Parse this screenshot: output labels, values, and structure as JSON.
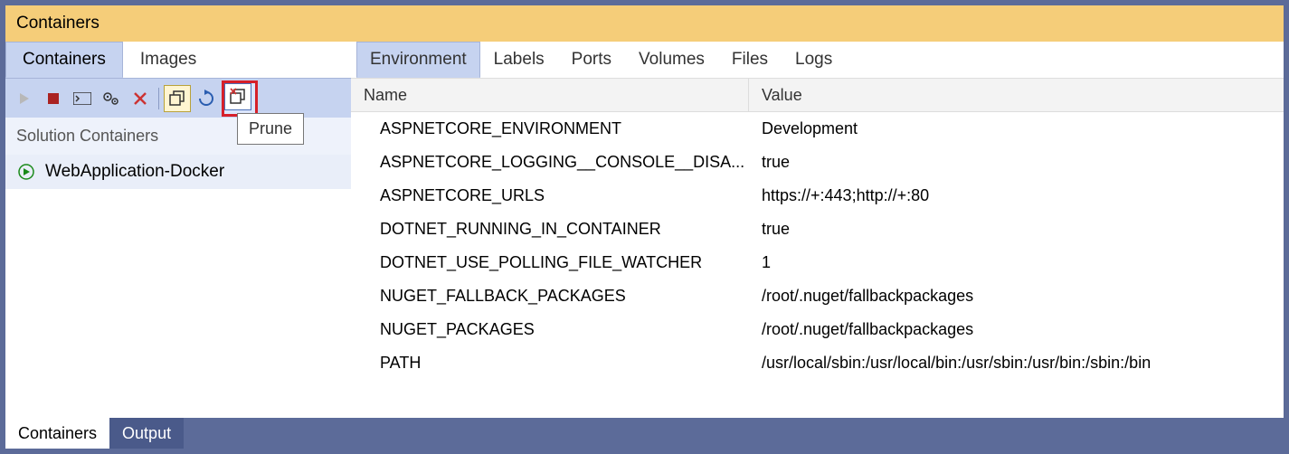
{
  "title": "Containers",
  "left_tabs": [
    "Containers",
    "Images"
  ],
  "left_active_tab": 0,
  "toolbar": {
    "play": "play-icon",
    "stop": "stop-icon",
    "terminal": "terminal-icon",
    "settings": "settings-icon",
    "delete": "delete-icon",
    "prune_stopped": "prune-stopped-icon",
    "refresh": "refresh-icon",
    "prune": "prune-icon",
    "tooltip": "Prune"
  },
  "section_header": "Solution Containers",
  "containers": [
    {
      "name": "WebApplication-Docker",
      "running": true
    }
  ],
  "right_tabs": [
    "Environment",
    "Labels",
    "Ports",
    "Volumes",
    "Files",
    "Logs"
  ],
  "right_active_tab": 0,
  "grid": {
    "columns": [
      "Name",
      "Value"
    ],
    "rows": [
      {
        "name": "ASPNETCORE_ENVIRONMENT",
        "value": "Development"
      },
      {
        "name": "ASPNETCORE_LOGGING__CONSOLE__DISA...",
        "value": "true"
      },
      {
        "name": "ASPNETCORE_URLS",
        "value": "https://+:443;http://+:80"
      },
      {
        "name": "DOTNET_RUNNING_IN_CONTAINER",
        "value": "true"
      },
      {
        "name": "DOTNET_USE_POLLING_FILE_WATCHER",
        "value": "1"
      },
      {
        "name": "NUGET_FALLBACK_PACKAGES",
        "value": "/root/.nuget/fallbackpackages"
      },
      {
        "name": "NUGET_PACKAGES",
        "value": "/root/.nuget/fallbackpackages"
      },
      {
        "name": "PATH",
        "value": "/usr/local/sbin:/usr/local/bin:/usr/sbin:/usr/bin:/sbin:/bin"
      }
    ]
  },
  "bottom_tabs": [
    "Containers",
    "Output"
  ],
  "bottom_active_tab": 0
}
